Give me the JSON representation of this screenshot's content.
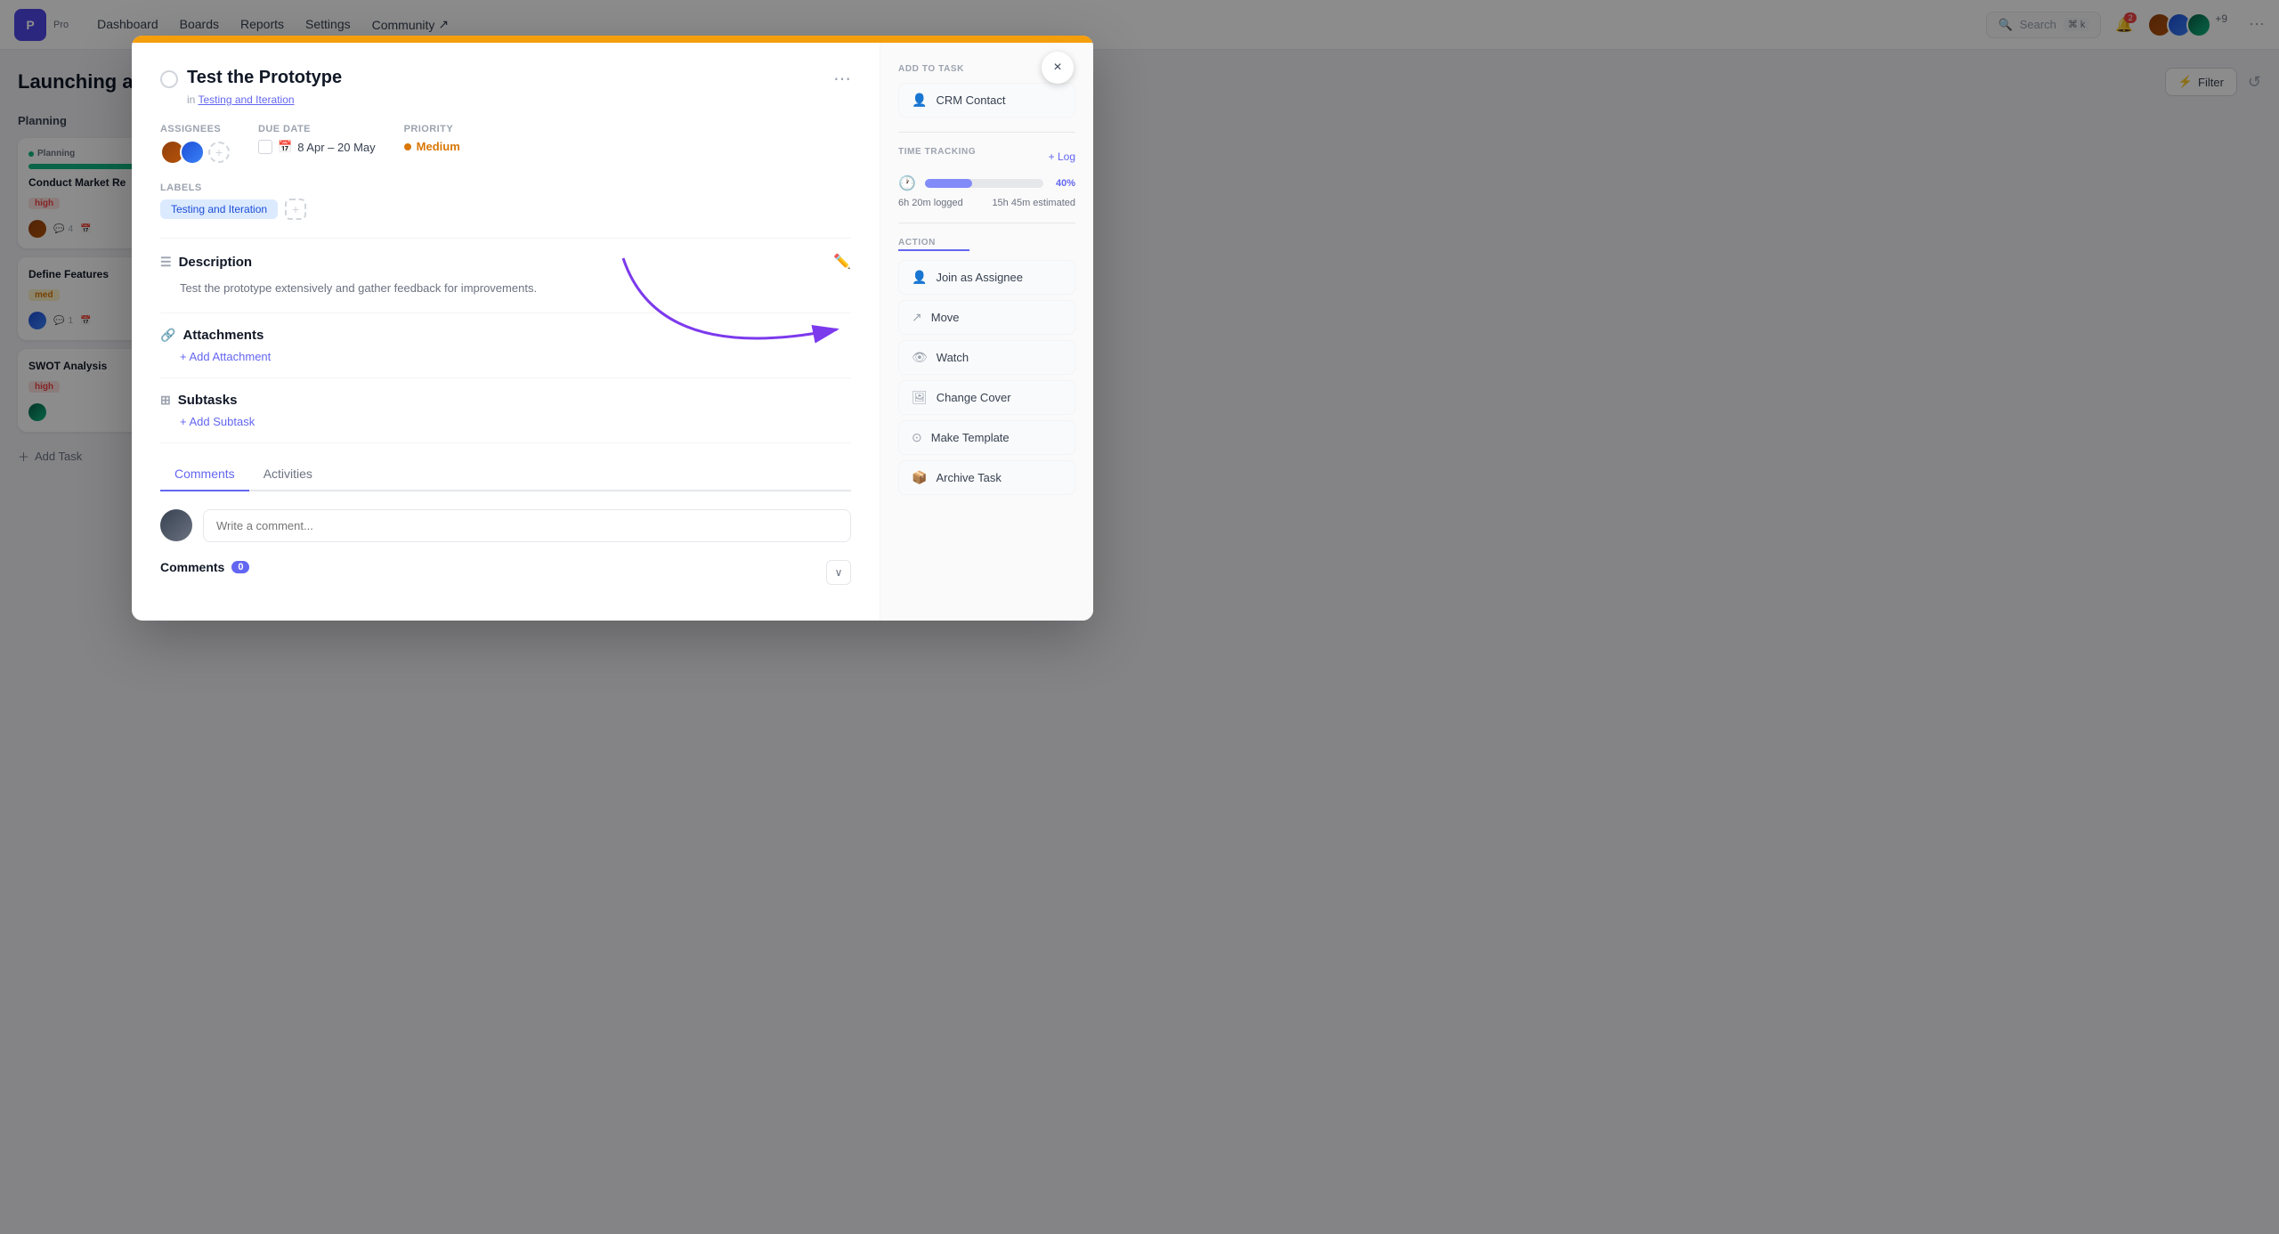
{
  "app": {
    "logo": "P",
    "plan": "Pro"
  },
  "topnav": {
    "links": [
      "Dashboard",
      "Boards",
      "Reports",
      "Settings",
      "Community ↗"
    ],
    "search_placeholder": "Search",
    "kbd_shortcut": "⌘ k",
    "notification_count": "2",
    "avatar_count": "+9",
    "external_icon": "↗"
  },
  "board": {
    "title": "Launching a New",
    "filter_label": "Filter",
    "columns": [
      {
        "title": "Planning",
        "count": "3",
        "cards": [
          {
            "tag": "Planning",
            "has_dot": true,
            "title": "Conduct Market Re",
            "priority": "high",
            "priority_label": "high",
            "meta_count": "4",
            "has_date": true
          }
        ]
      }
    ],
    "add_task_label": "Add Task"
  },
  "modal": {
    "orange_bar": true,
    "task_title": "Test the Prototype",
    "breadcrumb_prefix": "in",
    "breadcrumb_link": "Testing and Iteration",
    "assignees_label": "Assignees",
    "due_date_label": "Due Date",
    "due_date_value": "8 Apr – 20 May",
    "priority_label": "Priority",
    "priority_value": "Medium",
    "labels_label": "Labels",
    "label_chip": "Testing and Iteration",
    "description_label": "Description",
    "description_text": "Test the prototype extensively and gather feedback for improvements.",
    "attachments_label": "Attachments",
    "add_attachment": "+ Add Attachment",
    "subtasks_label": "Subtasks",
    "add_subtask": "+ Add Subtask",
    "tabs": [
      "Comments",
      "Activities"
    ],
    "active_tab": "Comments",
    "comment_placeholder": "Write a comment...",
    "comments_section_title": "Comments",
    "comments_count": "0"
  },
  "sidebar": {
    "add_to_task_label": "ADD TO TASK",
    "crm_contact_label": "CRM Contact",
    "time_tracking_label": "TIME TRACKING",
    "time_log_label": "+ Log",
    "time_percent": "40%",
    "time_logged": "6h 20m logged",
    "time_estimated": "15h 45m estimated",
    "action_label": "ACTION",
    "actions": [
      {
        "icon": "person",
        "label": "Join as Assignee"
      },
      {
        "icon": "arrow",
        "label": "Move"
      },
      {
        "icon": "eye",
        "label": "Watch"
      },
      {
        "icon": "image",
        "label": "Change Cover"
      },
      {
        "icon": "template",
        "label": "Make Template"
      },
      {
        "icon": "archive",
        "label": "Archive Task"
      }
    ]
  },
  "close_button_label": "×"
}
